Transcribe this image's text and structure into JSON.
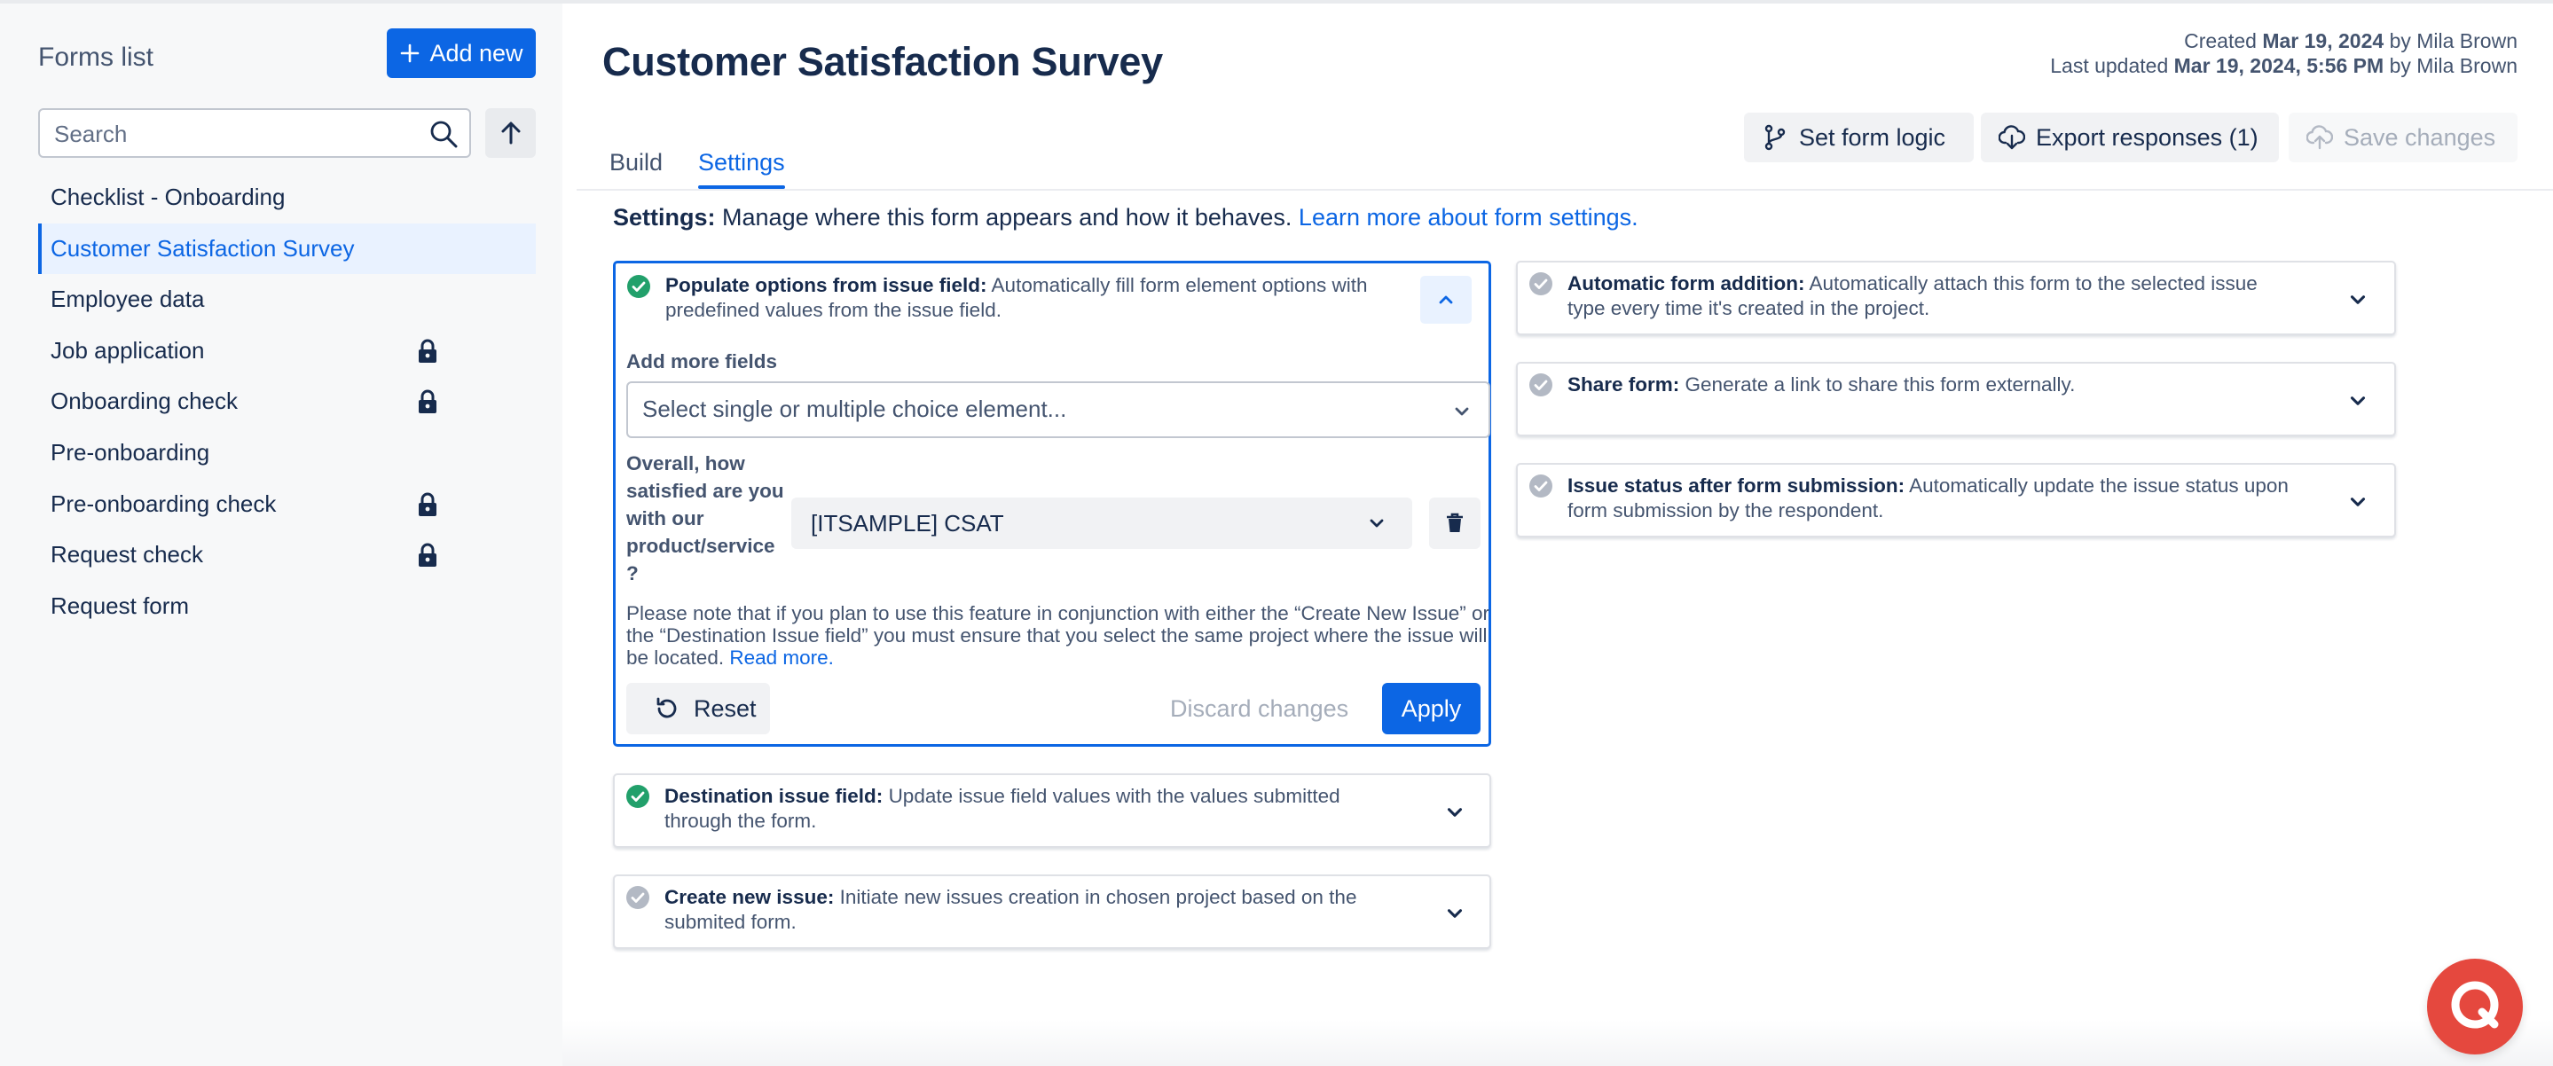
{
  "sidebar": {
    "title": "Forms list",
    "add_new_label": "Add new",
    "search_placeholder": "Search",
    "items": [
      {
        "label": "Checklist - Onboarding",
        "locked": false,
        "active": false
      },
      {
        "label": "Customer Satisfaction Survey",
        "locked": false,
        "active": true
      },
      {
        "label": "Employee data",
        "locked": false,
        "active": false
      },
      {
        "label": "Job application",
        "locked": true,
        "active": false
      },
      {
        "label": "Onboarding check",
        "locked": true,
        "active": false
      },
      {
        "label": "Pre-onboarding",
        "locked": false,
        "active": false
      },
      {
        "label": "Pre-onboarding check",
        "locked": true,
        "active": false
      },
      {
        "label": "Request check",
        "locked": true,
        "active": false
      },
      {
        "label": "Request form",
        "locked": false,
        "active": false
      }
    ]
  },
  "header": {
    "title": "Customer Satisfaction Survey",
    "created_prefix": "Created",
    "created_date": "Mar 19, 2024",
    "created_by": "by Mila Brown",
    "updated_prefix": "Last updated",
    "updated_date": "Mar 19, 2024, 5:56 PM",
    "updated_by": "by Mila Brown",
    "tabs": [
      {
        "label": "Build",
        "active": false
      },
      {
        "label": "Settings",
        "active": true
      }
    ],
    "set_logic_label": "Set form logic",
    "export_label": "Export responses (1)",
    "save_label": "Save changes"
  },
  "settings": {
    "intro_bold": "Settings:",
    "intro_text": "Manage where this form appears and how it behaves.",
    "intro_link": "Learn more about form settings."
  },
  "populate": {
    "title": "Populate options from issue field:",
    "desc_line1": "Automatically fill form element options with",
    "desc_line2": "predefined values from the issue field.",
    "add_fields_label": "Add more fields",
    "select_placeholder": "Select single or multiple choice element...",
    "question_label": "Overall, how satisfied are you with our product/service ?",
    "field_value": "[ITSAMPLE] CSAT",
    "note_text": "Please note that if you plan to use this feature in conjunction with either the “Create New Issue” or the “Destination Issue field” you must ensure that you select the same project where the issue will be located.",
    "note_link": "Read more.",
    "reset_label": "Reset",
    "discard_label": "Discard changes",
    "apply_label": "Apply",
    "status": "enabled"
  },
  "destination": {
    "title": "Destination issue field:",
    "desc_line1": "Update issue field values with the values submitted",
    "desc_line2": "through the form.",
    "status": "enabled"
  },
  "create_issue": {
    "title": "Create new issue:",
    "desc_line1": "Initiate new issues creation in chosen project based on the",
    "desc_line2": "submited form.",
    "status": "disabled"
  },
  "auto_add": {
    "title": "Automatic form addition:",
    "desc_line1": "Automatically attach this form to the selected issue",
    "desc_line2": "type every time it's created in the project.",
    "status": "disabled"
  },
  "share": {
    "title": "Share form:",
    "desc_line1": "Generate a link to share this form externally.",
    "status": "disabled"
  },
  "issue_status": {
    "title": "Issue status after form submission:",
    "desc_line1": "Automatically update the issue status upon",
    "desc_line2": "form submission by the respondent.",
    "status": "disabled"
  },
  "colors": {
    "accent": "#0c66e4",
    "enabled_status": "#22a06b",
    "disabled_status": "#b3b9c4",
    "help_button": "#e5483e"
  }
}
